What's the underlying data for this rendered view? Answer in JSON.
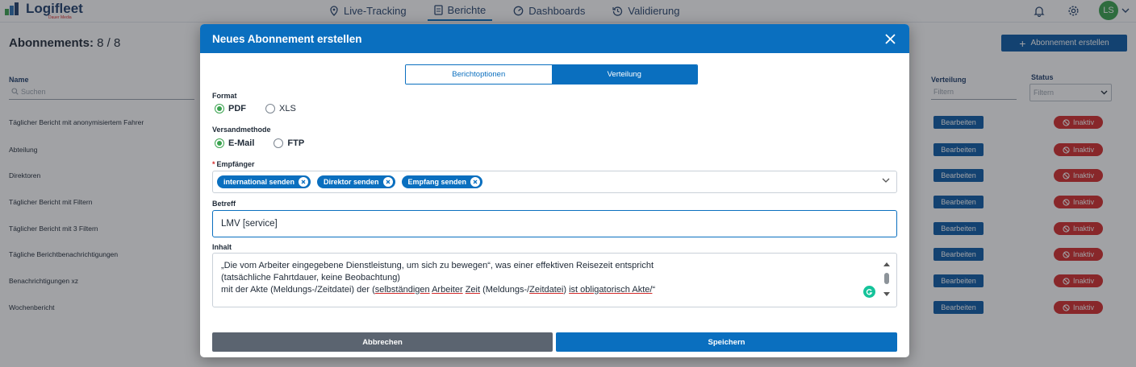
{
  "app": {
    "logo_text": "Logifleet",
    "logo_sub": "Dauer Media",
    "brand_color": "#0a6fbf"
  },
  "nav": {
    "items": [
      {
        "label": "Live-Tracking",
        "icon": "location-pin-icon"
      },
      {
        "label": "Berichte",
        "icon": "document-icon",
        "active": true
      },
      {
        "label": "Dashboards",
        "icon": "dashboard-icon"
      },
      {
        "label": "Validierung",
        "icon": "history-icon"
      }
    ]
  },
  "user": {
    "initials": "LS"
  },
  "page": {
    "title": "Abonnements:",
    "count": "8 / 8",
    "create_button": "Abonnement erstellen"
  },
  "table": {
    "columns": {
      "name": "Name",
      "name_placeholder": "Suchen",
      "verteilung": "Verteilung",
      "verteilung_placeholder": "Filtern",
      "status": "Status",
      "status_placeholder": "Filtern"
    },
    "edit_label": "Bearbeiten",
    "status_label": "Inaktiv",
    "rows": [
      "Täglicher Bericht mit anonymisiertem Fahrer",
      "Abteilung",
      "Direktoren",
      "Täglicher Bericht mit Filtern",
      "Täglicher Bericht mit 3 Filtern",
      "Tägliche Berichtbenachrichtigungen",
      "Benachrichtigungen xz",
      "Wochenbericht"
    ]
  },
  "modal": {
    "title": "Neues Abonnement erstellen",
    "tabs": [
      "Berichtoptionen",
      "Verteilung"
    ],
    "active_tab": 1,
    "format": {
      "label": "Format",
      "options": [
        "PDF",
        "XLS"
      ],
      "selected": "PDF"
    },
    "method": {
      "label": "Versandmethode",
      "options": [
        "E-Mail",
        "FTP"
      ],
      "selected": "E-Mail"
    },
    "recipients": {
      "label": "Empfänger",
      "required_mark": "*",
      "tags": [
        "international senden",
        "Direktor senden",
        "Empfang senden"
      ]
    },
    "subject": {
      "label": "Betreff",
      "value": "LMV [service]"
    },
    "content": {
      "label": "Inhalt",
      "line1": "„Die vom Arbeiter eingegebene Dienstleistung, um sich zu bewegen“, was einer effektiven Reisezeit entspricht",
      "line2": "(tatsächliche Fahrtdauer, keine Beobachtung)",
      "line3_a": "mit der Akte (Meldungs-/Zeitdatei) der (",
      "line3_u1": "selbständigen",
      "line3_s1": " ",
      "line3_u2": "Arbeiter",
      "line3_s2": " ",
      "line3_u3": "Zeit",
      "line3_b": " (Meldungs-/",
      "line3_u4": "Zeitdatei",
      "line3_c": ") ",
      "line3_u5": "ist obligatorisch Akte/",
      "line3_d": "“"
    },
    "cancel": "Abbrechen",
    "save": "Speichern"
  }
}
